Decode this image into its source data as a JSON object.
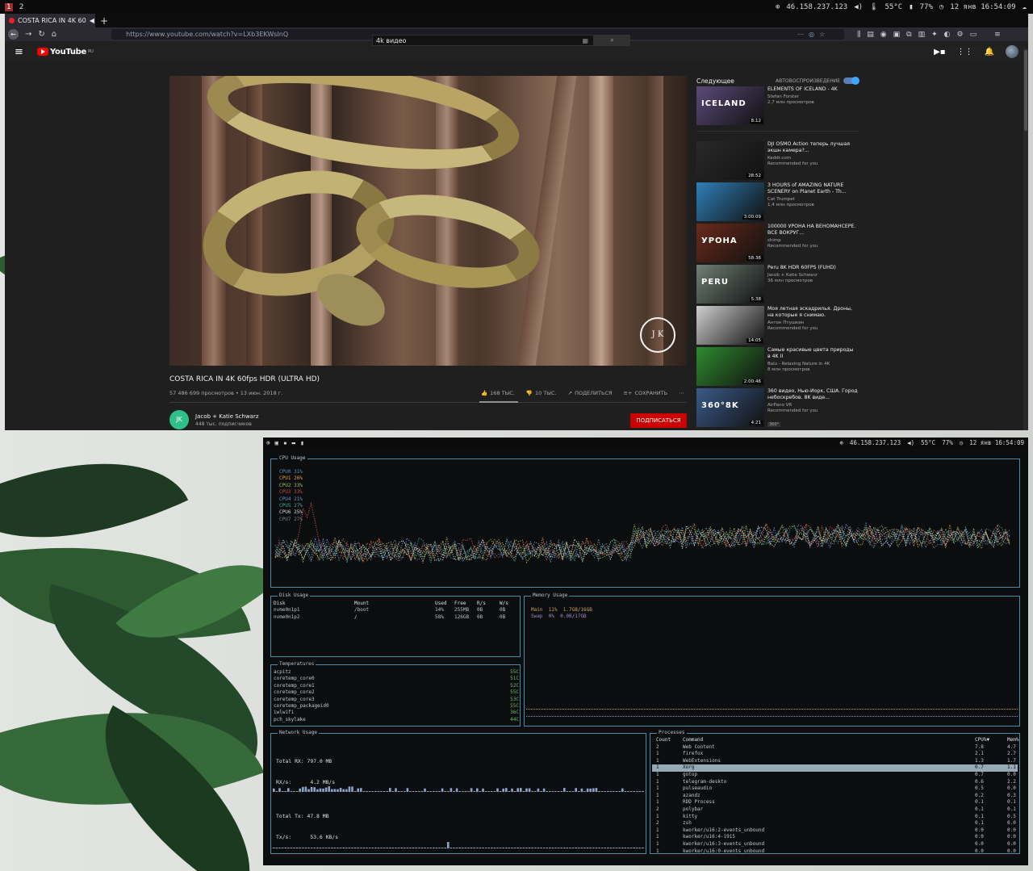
{
  "topbar": {
    "workspaces": [
      "1",
      "2"
    ],
    "ip": "46.158.237.123",
    "temp": "55°C",
    "battery": "77%",
    "clock": "12 янв 16:54:09"
  },
  "browser": {
    "tab_title": "COSTA RICA IN 4K 60",
    "url": "https://www.youtube.com/watch?v=LXb3EKWsInQ"
  },
  "youtube": {
    "logo": "YouTube",
    "region": "RU",
    "search_value": "4k видео",
    "video": {
      "title": "COSTA RICA IN 4K 60fps HDR (ULTRA HD)",
      "meta": "57 486 699 просмотров • 13 июн. 2018 г.",
      "likes": "168 ТЫС.",
      "dislikes": "10 ТЫС.",
      "share": "ПОДЕЛИТЬСЯ",
      "save": "СОХРАНИТЬ",
      "watermark": "J K"
    },
    "channel": {
      "name": "Jacob + Katie Schwarz",
      "subs": "448 тыс. подписчиков",
      "subscribe": "ПОДПИСАТЬСЯ"
    },
    "sidebar": {
      "next_label": "Следующее",
      "autoplay_label": "АВТОВОСПРОИЗВЕДЕНИЕ",
      "items": [
        {
          "title": "ELEMENTS OF ICELAND - 4K",
          "channel": "Stefan Forster",
          "views": "2,7 млн просмотров",
          "duration": "8:12",
          "thumb_text": "ICELAND",
          "thumb_color": "#5b4a7a"
        },
        {
          "title": "DJI OSMO Action теперь лучшая экшн камера?...",
          "channel": "Keddr.com",
          "views": "Recommended for you",
          "duration": "28:52",
          "thumb_text": "",
          "thumb_color": "#2a2a2a"
        },
        {
          "title": "3 HOURS of AMAZING NATURE SCENERY on Planet Earth - Th...",
          "channel": "Cat Trumpet",
          "views": "1,4 млн просмотров",
          "duration": "3:00:09",
          "thumb_text": "",
          "thumb_color": "#2f7fb8"
        },
        {
          "title": "100000 УРОНА НА ВЕНОМАНСЕРЕ. ВСЕ ВОКРУГ...",
          "channel": "shimp",
          "views": "Recommended for you",
          "duration": "58:36",
          "thumb_text": "УРОНА",
          "thumb_color": "#6a2a1a"
        },
        {
          "title": "Peru 8K HDR 60FPS (FUHD)",
          "channel": "Jacob + Katie Schwarz",
          "views": "36 млн просмотров",
          "duration": "5:38",
          "thumb_text": "PERU",
          "thumb_color": "#6f7f76"
        },
        {
          "title": "Моя летная эскадрилья. Дроны, на которые я снимаю.",
          "channel": "Антон Птушкин",
          "views": "Recommended for you",
          "duration": "14:05",
          "thumb_text": "",
          "thumb_color": "#cfcfcf"
        },
        {
          "title": "Самые красивые цвета природы в 4K II",
          "channel": "Balu - Relaxing Nature in 4K",
          "views": "8 млн просмотров",
          "duration": "2:00:46",
          "thumb_text": "",
          "thumb_color": "#2f8a2f"
        },
        {
          "title": "360 видео, Нью-Йорк, США. Город небоскребов. 8K виде...",
          "channel": "AirPano VR",
          "views": "Recommended for you",
          "duration": "4:21",
          "thumb_text": "360°8K",
          "thumb_color": "#3a5a8a",
          "badge": "360°"
        }
      ]
    }
  },
  "gotop": {
    "cpu": {
      "title": "CPU Usage",
      "cores": [
        {
          "label": "CPU0",
          "value": "31%",
          "color": "#5b8fb5"
        },
        {
          "label": "CPU1",
          "value": "26%",
          "color": "#e0a040"
        },
        {
          "label": "CPU2",
          "value": "33%",
          "color": "#9bc25a"
        },
        {
          "label": "CPU3",
          "value": "33%",
          "color": "#c94a4a"
        },
        {
          "label": "CPU4",
          "value": "21%",
          "color": "#6a8fc8"
        },
        {
          "label": "CPU5",
          "value": "27%",
          "color": "#4aa8a0"
        },
        {
          "label": "CPU6",
          "value": "25%",
          "color": "#d8d8d8"
        },
        {
          "label": "CPU7",
          "value": "27%",
          "color": "#808080"
        }
      ]
    },
    "disk": {
      "title": "Disk Usage",
      "headers": [
        "Disk",
        "Mount",
        "Used",
        "Free",
        "R/s",
        "W/s"
      ],
      "rows": [
        [
          "nvme0n1p1",
          "/boot",
          "14%",
          "255MB",
          "0B",
          "0B"
        ],
        [
          "nvme0n1p2",
          "/",
          "58%",
          "126GB",
          "0B",
          "0B"
        ]
      ]
    },
    "memory": {
      "title": "Memory Usage",
      "rows": [
        {
          "label": "Main",
          "pct": "11%",
          "val": "1.7GB/16GB",
          "color": "#c9a25a"
        },
        {
          "label": "Swap",
          "pct": "0%",
          "val": "0.0B/17GB",
          "color": "#a58ac8"
        }
      ]
    },
    "temps": {
      "title": "Temperatures",
      "rows": [
        [
          "acpitz",
          "55C"
        ],
        [
          "coretemp_core0",
          "51C"
        ],
        [
          "coretemp_core1",
          "52C"
        ],
        [
          "coretemp_core2",
          "55C"
        ],
        [
          "coretemp_core3",
          "53C"
        ],
        [
          "coretemp_packageid0",
          "55C"
        ],
        [
          "iwlwifi",
          "36C"
        ],
        [
          "pch_skylake",
          "44C"
        ]
      ]
    },
    "network": {
      "title": "Network Usage",
      "total_rx_label": "Total RX:",
      "total_rx": "797.0 MB",
      "rx_label": "RX/s:",
      "rx": "4.2 MB/s",
      "total_tx_label": "Total Tx:",
      "total_tx": "47.8 MB",
      "tx_label": "Tx/s:",
      "tx": "53.6 KB/s"
    },
    "processes": {
      "title": "Processes",
      "headers": [
        "Count",
        "Command",
        "CPU%▼",
        "Mem%"
      ],
      "rows": [
        [
          "2",
          "Web Content",
          "7.8",
          "4.7"
        ],
        [
          "1",
          "firefox",
          "2.1",
          "2.7"
        ],
        [
          "1",
          "WebExtensions",
          "1.3",
          "1.7"
        ],
        [
          "1",
          "Xorg",
          "0.7",
          "1.1"
        ],
        [
          "1",
          "gotop",
          "0.7",
          "0.0"
        ],
        [
          "1",
          "telegram-deskto",
          "0.6",
          "2.2"
        ],
        [
          "1",
          "pulseaudio",
          "0.5",
          "0.0"
        ],
        [
          "1",
          "azandz",
          "0.2",
          "0.3"
        ],
        [
          "1",
          "RDD Process",
          "0.1",
          "0.1"
        ],
        [
          "2",
          "polybar",
          "0.1",
          "0.1"
        ],
        [
          "1",
          "kitty",
          "0.1",
          "0.5"
        ],
        [
          "2",
          "zsh",
          "0.1",
          "0.0"
        ],
        [
          "1",
          "kworker/u16:2-events_unbound",
          "0.0",
          "0.0"
        ],
        [
          "1",
          "kworker/u16:4-i915",
          "0.0",
          "0.0"
        ],
        [
          "1",
          "kworker/u16:3-events_unbound",
          "0.0",
          "0.0"
        ],
        [
          "1",
          "kworker/u16:0-events_unbound",
          "0.0",
          "0.0"
        ]
      ],
      "selected_index": 3
    }
  }
}
